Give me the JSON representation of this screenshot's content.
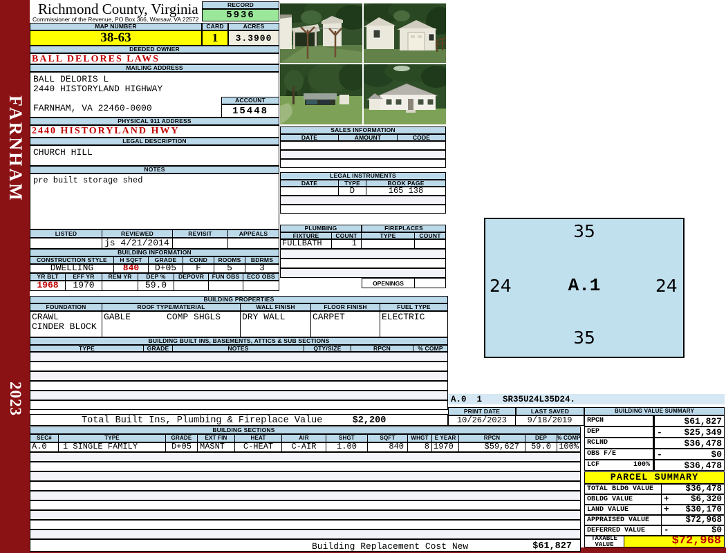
{
  "colors": {
    "maroon": "#8A1114",
    "header_blue": "#BCD9EA",
    "yellow": "#FFFF00",
    "record_green": "#9BE89B",
    "acres_beige": "#F0EEE0",
    "red_text": "#C00000",
    "sketch_fill": "#C1E0EE",
    "stripe": "#F3F3FA"
  },
  "sidebar": {
    "district": "FARNHAM",
    "year": "2023"
  },
  "header": {
    "title": "Richmond County, Virginia",
    "subtitle": "Commissioner of the Revenue, PO Box 366, Warsaw, VA 22572",
    "record_label": "RECORD",
    "record": "5936",
    "map_label": "MAP NUMBER",
    "map": "38-63",
    "card_label": "CARD",
    "card": "1",
    "acres_label": "ACRES",
    "acres": "3.3900"
  },
  "owner": {
    "deeded_label": "DEEDED OWNER",
    "deeded": "BALL DELORES LAWS",
    "mailing_label": "MAILING ADDRESS",
    "mail1": "BALL DELORIS L",
    "mail2": "2440 HISTORYLAND HIGHWAY",
    "mail3": "FARNHAM, VA 22460-0000",
    "account_label": "ACCOUNT",
    "account": "15448",
    "physical_label": "PHYSICAL 911 ADDRESS",
    "physical": "2440 HISTORYLAND HWY",
    "legal_label": "LEGAL DESCRIPTION",
    "legal": "CHURCH HILL",
    "notes_label": "NOTES",
    "notes": "pre built storage shed"
  },
  "review": {
    "l1": "LISTED",
    "l2": "REVIEWED",
    "l3": "REVISIT",
    "l4": "APPEALS",
    "reviewed": "js  4/21/2014"
  },
  "bldg_info": {
    "title": "BUILDING INFORMATION",
    "h1": [
      "CONSTRUCTION STYLE",
      "H SQFT",
      "GRADE",
      "COND",
      "ROOMS",
      "BDRMS"
    ],
    "v1": [
      "DWELLING",
      "840",
      "D+05",
      "F",
      "5",
      "3"
    ],
    "h2": [
      "YR BLT",
      "EFF YR",
      "REM YR",
      "DEP %",
      "DEPOVR",
      "FUN OBS",
      "ECO OBS"
    ],
    "v2": [
      "1968",
      "1970",
      "",
      "59.0",
      "",
      "",
      ""
    ]
  },
  "bldg_props": {
    "title": "BUILDING PROPERTIES",
    "cols": [
      "FOUNDATION",
      "ROOF TYPE/MATERIAL",
      "WALL FINISH",
      "FLOOR FINISH",
      "FUEL TYPE"
    ],
    "foundation1": "CRAWL",
    "foundation2": "CINDER BLOCK",
    "roof_type": "GABLE",
    "roof_material": "COMP SHGLS",
    "wall": "DRY WALL",
    "floor": "CARPET",
    "fuel": "ELECTRIC"
  },
  "built_ins": {
    "title": "BUILDING BUILT INS, BASEMENTS, ATTICS & SUB SECTIONS",
    "cols": [
      "TYPE",
      "GRADE",
      "NOTES",
      "QTY/SIZE",
      "RPCN",
      "% COMP"
    ]
  },
  "sales": {
    "title": "SALES INFORMATION",
    "cols": [
      "DATE",
      "AMOUNT",
      "CODE"
    ]
  },
  "instruments": {
    "title": "LEGAL INSTRUMENTS",
    "cols": [
      "DATE",
      "TYPE",
      "BOOK PAGE"
    ],
    "row": [
      "",
      "D",
      "165 138"
    ]
  },
  "plumbing": {
    "title": "PLUMBING",
    "cols": [
      "FIXTURE",
      "COUNT"
    ],
    "fixture": "FULLBATH",
    "count": "1"
  },
  "fireplaces": {
    "title": "FIREPLACES",
    "cols": [
      "TYPE",
      "COUNT"
    ],
    "openings": "OPENINGS"
  },
  "sketch": {
    "top": "35",
    "left": "24",
    "center": "A.1",
    "right": "24",
    "bottom": "35",
    "code": "A.0  1    SR35U24L35D24."
  },
  "totals": {
    "built_ins_label": "Total Built Ins, Plumbing & Fireplace Value",
    "built_ins_value": "$2,200",
    "brcn_label": "Building Replacement Cost New",
    "brcn_value": "$61,827"
  },
  "sections": {
    "title": "BUILDING SECTIONS",
    "cols": [
      "SEC#",
      "TYPE",
      "GRADE",
      "EXT FIN",
      "HEAT",
      "AIR",
      "SHGT",
      "SQFT",
      "WHGT",
      "E YEAR",
      "RPCN",
      "DEP",
      "% COMP"
    ],
    "row": [
      "A.0",
      "1 SINGLE FAMILY",
      "D+05",
      "MASNT",
      "C-HEAT",
      "C-AIR",
      "1.00",
      "840",
      "8",
      "1970",
      "$59,627",
      "59.0",
      "100%"
    ]
  },
  "meta": {
    "print_label": "PRINT DATE",
    "print": "10/26/2023",
    "saved_label": "LAST SAVED",
    "saved": "9/18/2019"
  },
  "bvs": {
    "title": "BUILDING VALUE SUMMARY",
    "rows": [
      {
        "label": "RPCN",
        "pct": "",
        "sign": "",
        "value": "$61,827"
      },
      {
        "label": "DEP",
        "pct": "",
        "sign": "-",
        "value": "$25,349"
      },
      {
        "label": "RCLND",
        "pct": "",
        "sign": "",
        "value": "$36,478"
      },
      {
        "label": "OBS F/E",
        "pct": "",
        "sign": "-",
        "value": "$0"
      },
      {
        "label": "LCF",
        "pct": "100%",
        "sign": "",
        "value": "$36,478"
      }
    ]
  },
  "parcel": {
    "title": "PARCEL SUMMARY",
    "rows": [
      {
        "label": "TOTAL BLDG VALUE",
        "sign": "",
        "value": "$36,478"
      },
      {
        "label": "OBLDG VALUE",
        "sign": "+",
        "value": "$6,320"
      },
      {
        "label": "LAND VALUE",
        "sign": "+",
        "value": "$30,170"
      },
      {
        "label": "APPRAISED VALUE",
        "sign": "",
        "value": "$72,968"
      },
      {
        "label": "DEFERRED VALUE",
        "sign": "-",
        "value": "$0"
      }
    ],
    "taxable_label": "TAXABLE VALUE",
    "taxable": "$72,968"
  }
}
